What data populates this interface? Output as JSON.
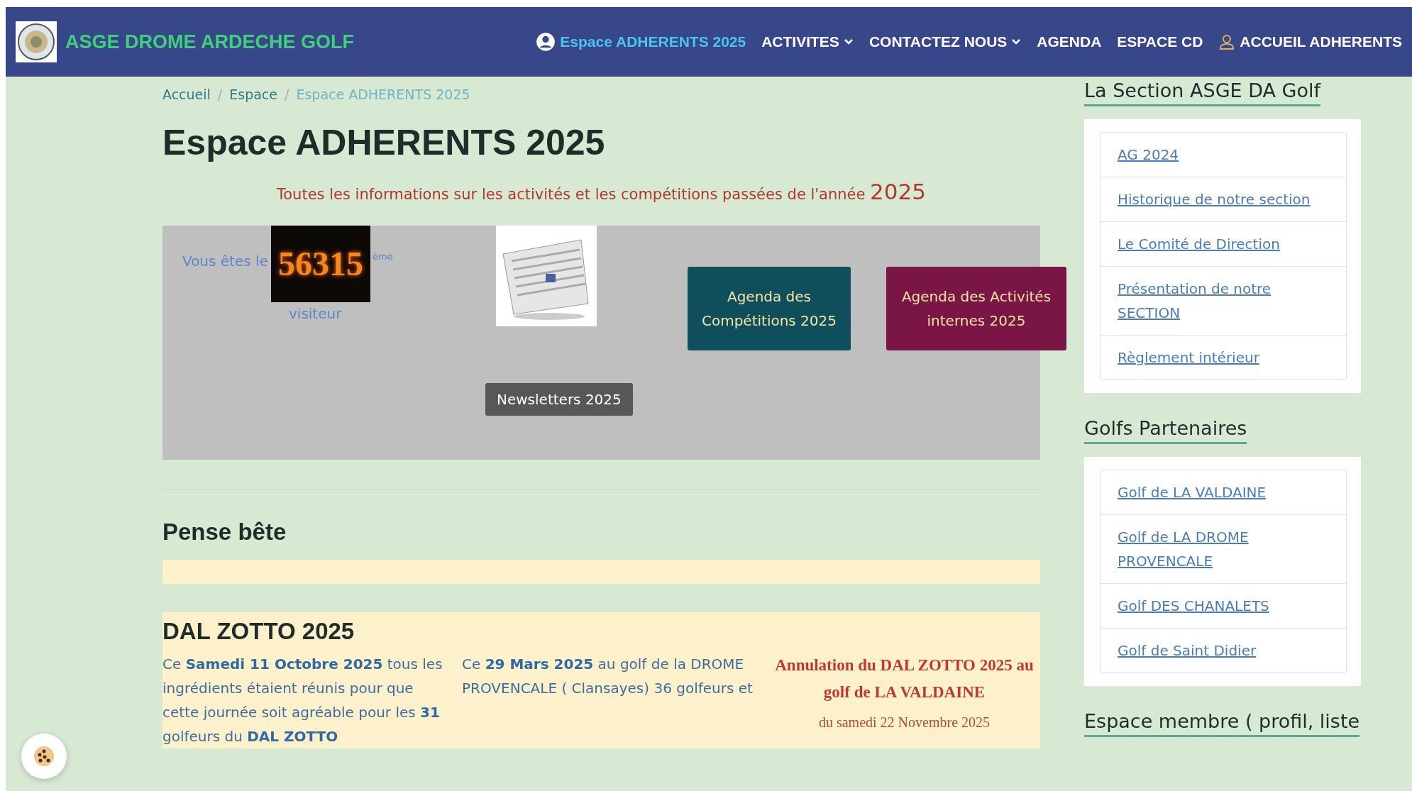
{
  "header": {
    "site_title": "ASGE DROME ARDECHE GOLF",
    "nav": [
      {
        "label": "Espace ADHERENTS 2025",
        "kind": "account",
        "selected": true
      },
      {
        "label": "ACTIVITES",
        "kind": "dropdown",
        "selected": false
      },
      {
        "label": "CONTACTEZ NOUS",
        "kind": "dropdown",
        "selected": false
      },
      {
        "label": "AGENDA",
        "kind": "plain",
        "selected": false
      },
      {
        "label": "ESPACE CD",
        "kind": "plain",
        "selected": false
      },
      {
        "label": "ACCUEIL ADHERENTS",
        "kind": "member",
        "selected": false
      }
    ]
  },
  "breadcrumb": {
    "separator": "/",
    "items": [
      {
        "label": "Accueil",
        "selected": false
      },
      {
        "label": "Espace",
        "selected": false
      },
      {
        "label": "Espace ADHERENTS 2025",
        "selected": true
      }
    ]
  },
  "page_title": "Espace ADHERENTS 2025",
  "subtitle": {
    "text": "Toutes les informations sur les activités et les compétitions passées de l'année",
    "year": "2025"
  },
  "banner": {
    "counter_prefix": "Vous êtes le",
    "counter_value": "56315",
    "counter_suffix": "ème",
    "counter_label": "visiteur",
    "newsletter_button": "Newsletters 2025",
    "agenda_buttons": [
      {
        "label": "Agenda des Compétitions 2025",
        "color": "#0f4f5c"
      },
      {
        "label": "Agenda des Activités internes 2025",
        "color": "#7a1645"
      }
    ]
  },
  "reminder": {
    "title": "Pense bête"
  },
  "dal_zotto": {
    "title": "DAL ZOTTO 2025",
    "column_1": "Ce **Samedi 11 Octobre 2025** tous les ingrédients étaient réunis pour que cette journée soit agréable pour les **31** golfeurs du **DAL ZOTTO**",
    "column_2": "Ce **29 Mars 2025** au golf de la DROME PROVENCALE ( Clansayes) 36 golfeurs et",
    "column_3_title": "Annulation du DAL ZOTTO 2025 au golf de LA VALDAINE",
    "column_3_text": "du samedi 22 Novembre 2025"
  },
  "sidebar": [
    {
      "title": "La Section ASGE DA Golf",
      "links": [
        "AG 2024",
        "Historique de notre section",
        "Le Comité de Direction",
        "Présentation de notre SECTION",
        "Règlement intérieur"
      ]
    },
    {
      "title": "Golfs Partenaires",
      "links": [
        "Golf de LA VALDAINE",
        "Golf de LA DROME PROVENCALE",
        "Golf DES CHANALETS",
        "Golf de Saint Didier"
      ]
    },
    {
      "title": "Espace membre ( profil, liste"
    }
  ]
}
